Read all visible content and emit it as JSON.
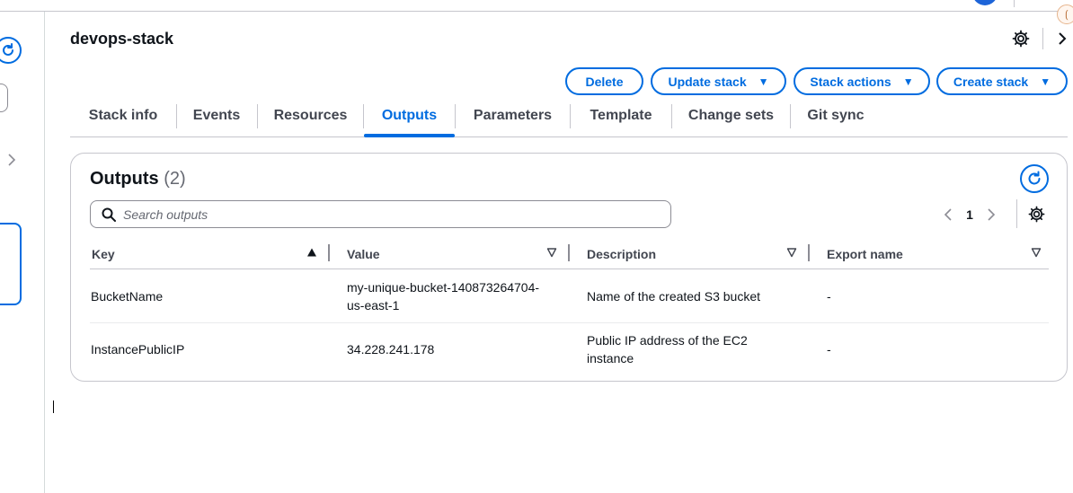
{
  "stack_name": "devops-stack",
  "top_badge": "⟮",
  "actions": {
    "delete": "Delete",
    "update_stack": "Update stack",
    "stack_actions": "Stack actions",
    "create_stack": "Create stack",
    "caret": "▼"
  },
  "tabs": [
    {
      "label": "Stack info",
      "active": false
    },
    {
      "label": "Events",
      "active": false
    },
    {
      "label": "Resources",
      "active": false
    },
    {
      "label": "Outputs",
      "active": true
    },
    {
      "label": "Parameters",
      "active": false
    },
    {
      "label": "Template",
      "active": false
    },
    {
      "label": "Change sets",
      "active": false
    },
    {
      "label": "Git sync",
      "active": false
    }
  ],
  "outputs": {
    "title": "Outputs",
    "count": "(2)",
    "search_placeholder": "Search outputs",
    "current_page": "1",
    "columns": [
      {
        "label": "Key",
        "sort": "ascending"
      },
      {
        "label": "Value",
        "sort": "none"
      },
      {
        "label": "Description",
        "sort": "none"
      },
      {
        "label": "Export name",
        "sort": "none"
      }
    ],
    "rows": [
      {
        "key": "BucketName",
        "value_line1": "my-unique-bucket-140873264704-",
        "value_line2": "us-east-1",
        "description_line1": "Name of the created S3 bucket",
        "description_line2": "",
        "export_name": "-"
      },
      {
        "key": "InstancePublicIP",
        "value_line1": "34.228.241.178",
        "value_line2": "",
        "description_line1": "Public IP address of the EC2",
        "description_line2": "instance",
        "export_name": "-"
      }
    ]
  },
  "colors": {
    "accent": "#006ce0",
    "text": "#0f141a",
    "muted": "#424650",
    "border": "#c6c6cd"
  },
  "icons": [
    "refresh-icon",
    "gear-icon",
    "chevron-right-icon",
    "chevron-left-icon",
    "search-icon",
    "sort-ascending-icon",
    "sort-icon",
    "caret-down-icon"
  ]
}
